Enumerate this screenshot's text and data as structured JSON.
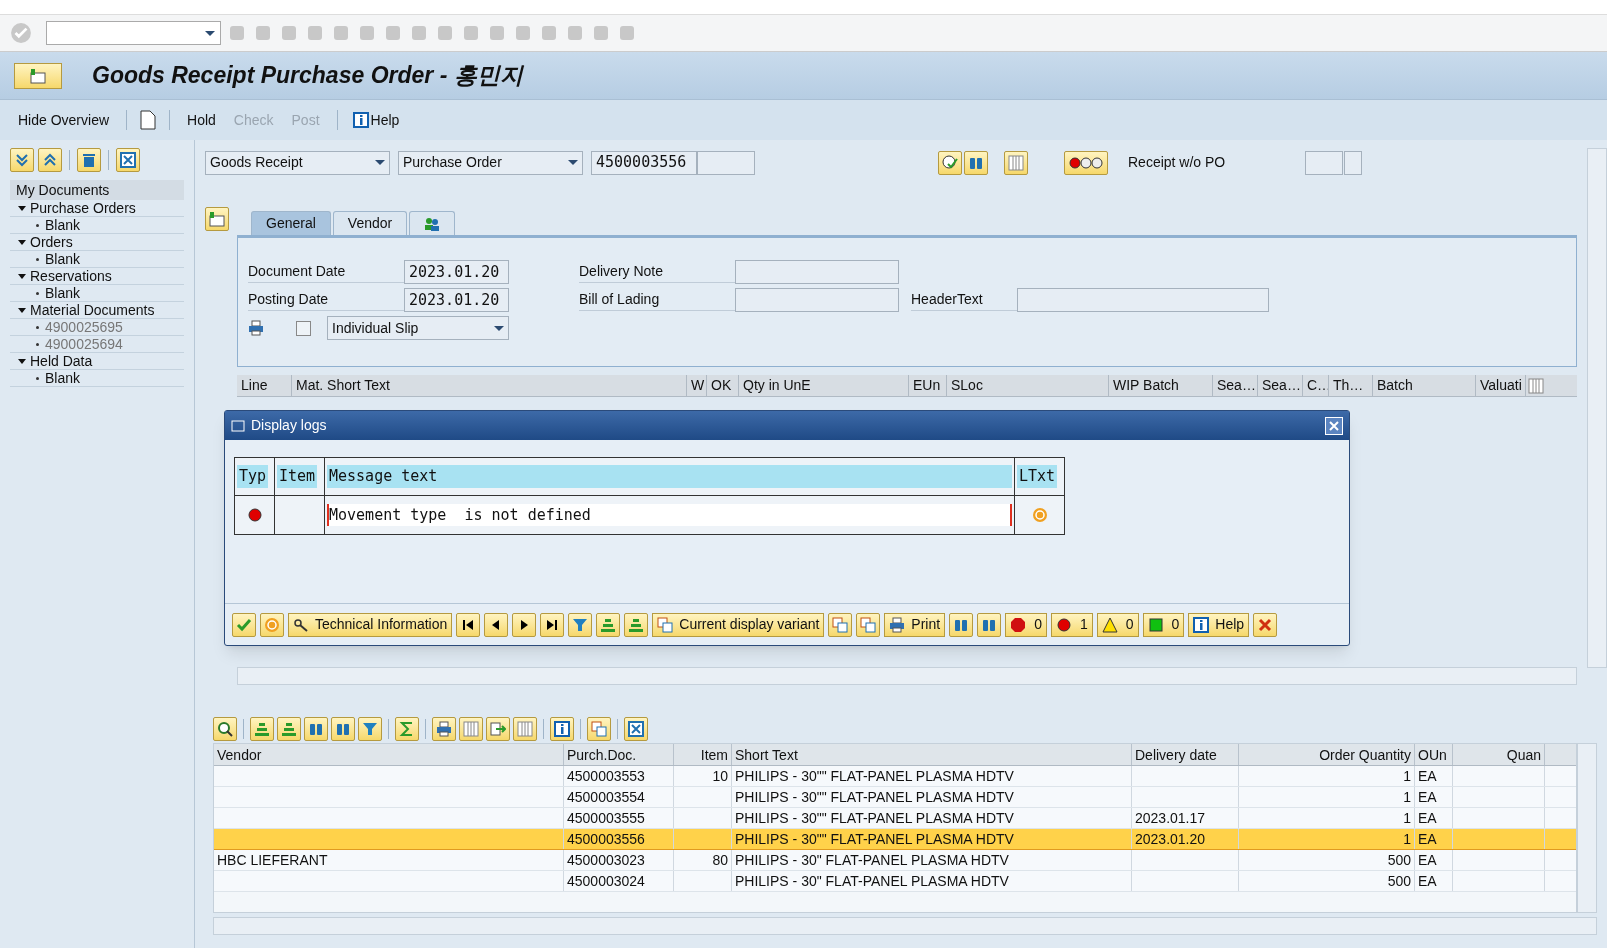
{
  "title": "Goods Receipt Purchase Order - 홍민지",
  "app_toolbar": [
    {
      "kind": "text",
      "label": "Hide Overview",
      "disabled": false
    },
    {
      "kind": "doc"
    },
    {
      "kind": "text",
      "label": "Hold",
      "disabled": false
    },
    {
      "kind": "text",
      "label": "Check",
      "disabled": true
    },
    {
      "kind": "text",
      "label": "Post",
      "disabled": true
    },
    {
      "kind": "info",
      "label": "Help",
      "disabled": false
    }
  ],
  "sidebar": {
    "title": "My Documents",
    "items": [
      {
        "label": "Purchase Orders",
        "expanded": true,
        "children": [
          {
            "label": "Blank",
            "greyed": false
          }
        ]
      },
      {
        "label": "Orders",
        "expanded": true,
        "children": [
          {
            "label": "Blank",
            "greyed": false
          }
        ]
      },
      {
        "label": "Reservations",
        "expanded": true,
        "children": [
          {
            "label": "Blank",
            "greyed": false
          }
        ]
      },
      {
        "label": "Material Documents",
        "expanded": true,
        "children": [
          {
            "label": "4900025695",
            "greyed": true
          },
          {
            "label": "4900025694",
            "greyed": true
          }
        ]
      },
      {
        "label": "Held Data",
        "expanded": true,
        "children": [
          {
            "label": "Blank",
            "greyed": false
          }
        ]
      }
    ]
  },
  "header": {
    "transaction": "Goods Receipt",
    "reference": "Purchase Order",
    "po_number": "4500003556",
    "receipt_label": "Receipt w/o PO"
  },
  "tabs": [
    {
      "kind": "text",
      "label": "General",
      "selected": true
    },
    {
      "kind": "text",
      "label": "Vendor",
      "selected": false
    },
    {
      "kind": "icon",
      "selected": false
    }
  ],
  "general": {
    "document_date_label": "Document Date",
    "document_date": "2023.01.20",
    "posting_date_label": "Posting Date",
    "posting_date": "2023.01.20",
    "delivery_note_label": "Delivery Note",
    "bill_of_lading_label": "Bill of Lading",
    "header_text_label": "HeaderText",
    "print_checked": false,
    "slip": "Individual Slip"
  },
  "item_grid": {
    "columns": [
      "Line",
      "Mat. Short Text",
      "W",
      "OK",
      "Qty in UnE",
      "EUn",
      "SLoc",
      "WIP Batch",
      "Sea…",
      "Sea…",
      "C…",
      "Th…",
      "Batch",
      "Valuati"
    ]
  },
  "dialog": {
    "title": "Display logs",
    "columns": [
      "Typ",
      "Item",
      "Message text",
      "LTxt"
    ],
    "rows": [
      {
        "kind": "error",
        "message": "Movement type  is not defined"
      }
    ],
    "technical_information": "Technical Information",
    "display_variant": "Current display variant",
    "print": "Print",
    "help": "Help",
    "counters": [
      {
        "kind": "stop",
        "count": "0"
      },
      {
        "kind": "error",
        "count": "1"
      },
      {
        "kind": "warning",
        "count": "0"
      },
      {
        "kind": "ok",
        "count": "0"
      }
    ]
  },
  "po_list": {
    "columns": [
      "Vendor",
      "Purch.Doc.",
      "Item",
      "Short Text",
      "Delivery date",
      "Order Quantity",
      "OUn",
      "Quan"
    ],
    "rows": [
      {
        "purch_doc": "4500003553",
        "item": "10",
        "short_text": "PHILIPS - 30\"\" FLAT-PANEL PLASMA HDTV",
        "quantity": "1",
        "unit": "EA",
        "selected": false
      },
      {
        "purch_doc": "4500003554",
        "short_text": "PHILIPS - 30\"\" FLAT-PANEL PLASMA HDTV",
        "quantity": "1",
        "unit": "EA",
        "selected": false
      },
      {
        "purch_doc": "4500003555",
        "short_text": "PHILIPS - 30\"\" FLAT-PANEL PLASMA HDTV",
        "delivery_date": "2023.01.17",
        "quantity": "1",
        "unit": "EA",
        "selected": false
      },
      {
        "purch_doc": "4500003556",
        "short_text": "PHILIPS - 30\"\" FLAT-PANEL PLASMA HDTV",
        "delivery_date": "2023.01.20",
        "quantity": "1",
        "unit": "EA",
        "selected": true
      },
      {
        "vendor": "HBC LIEFERANT",
        "purch_doc": "4500003023",
        "item": "80",
        "short_text": "PHILIPS - 30\" FLAT-PANEL PLASMA HDTV",
        "quantity": "500",
        "unit": "EA",
        "selected": false
      },
      {
        "purch_doc": "4500003024",
        "short_text": "PHILIPS - 30\" FLAT-PANEL PLASMA HDTV",
        "quantity": "500",
        "unit": "EA",
        "selected": false
      }
    ]
  }
}
